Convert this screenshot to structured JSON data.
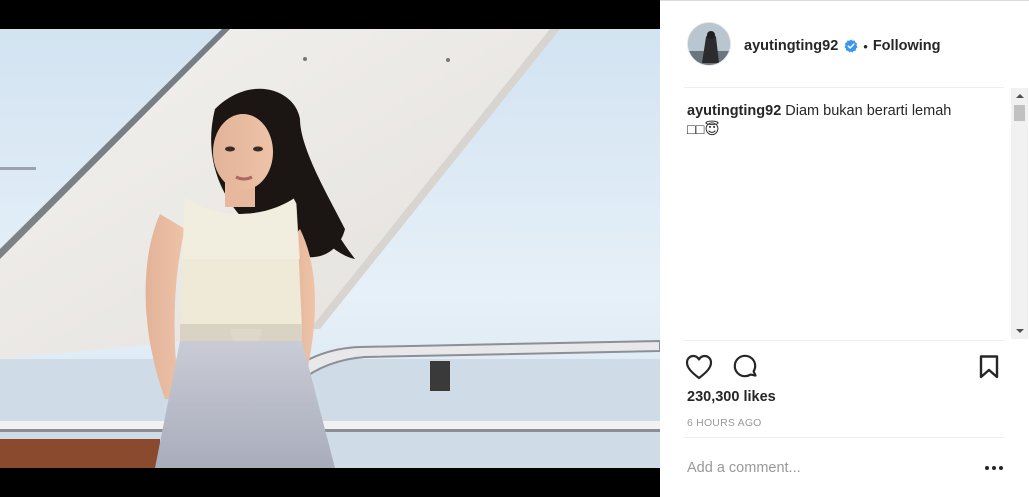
{
  "post": {
    "username": "ayutingting92",
    "follow_status": "Following",
    "separator": "•",
    "caption_username": "ayutingting92",
    "caption_text": "Diam bukan berarti lemah",
    "caption_emoji": "□□😇",
    "likes": "230,300 likes",
    "timestamp": "6 HOURS AGO",
    "comment_placeholder": "Add a comment..."
  },
  "icons": {
    "verified": "verified-badge-icon",
    "like": "heart-icon",
    "comment": "speech-bubble-icon",
    "save": "bookmark-icon",
    "more": "ellipsis-icon"
  },
  "colors": {
    "verified_blue": "#3897f0",
    "text": "#262626",
    "muted": "#999999",
    "divider": "#efefef"
  }
}
